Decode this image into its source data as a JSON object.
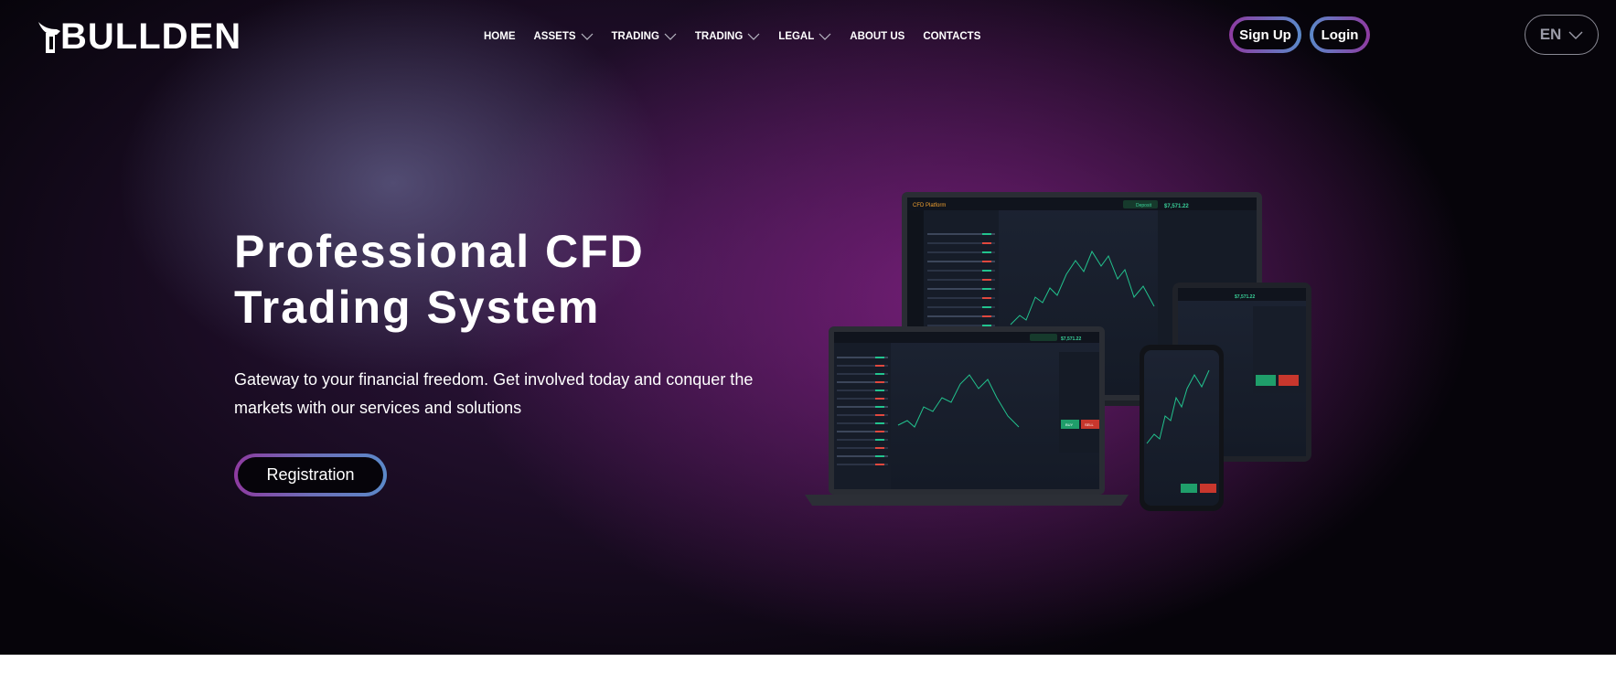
{
  "brand": {
    "name": "BULLDEN"
  },
  "nav": {
    "items": [
      {
        "label": "HOME",
        "has_dropdown": false
      },
      {
        "label": "ASSETS",
        "has_dropdown": true
      },
      {
        "label": "TRADING",
        "has_dropdown": true
      },
      {
        "label": "TRADING",
        "has_dropdown": true
      },
      {
        "label": "LEGAL",
        "has_dropdown": true
      },
      {
        "label": "ABOUT US",
        "has_dropdown": false
      },
      {
        "label": "CONTACTS",
        "has_dropdown": false
      }
    ]
  },
  "header": {
    "signup_label": "Sign Up",
    "login_label": "Login",
    "language": "EN"
  },
  "hero": {
    "title_line1": "Professional CFD",
    "title_line2": "Trading System",
    "subtitle": "Gateway to your financial freedom. Get involved today and conquer the markets with our services and solutions",
    "cta_label": "Registration"
  },
  "illustration": {
    "app_name": "CFD Platform",
    "deposit_label": "Deposit",
    "balance": "$7,571.22",
    "buy_label": "BUY",
    "sell_label": "SELL"
  },
  "colors": {
    "accent_purple": "#8e3aa0",
    "accent_blue": "#5b89c9",
    "background": "#06040a",
    "chart_up": "#22c38e",
    "chart_down": "#e0483e"
  }
}
